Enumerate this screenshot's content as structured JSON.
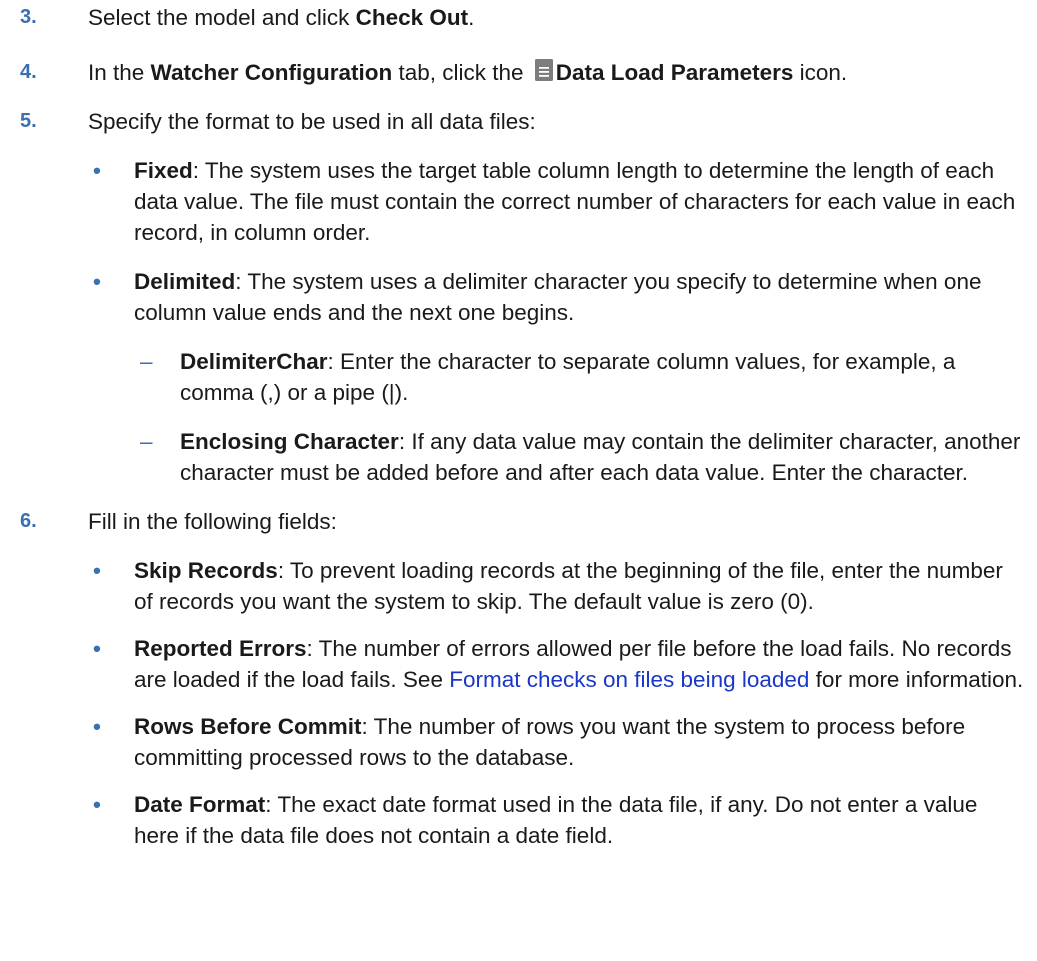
{
  "steps": [
    {
      "num": "3.",
      "pre": "Select the model and click ",
      "bold": "Check Out",
      "post": "."
    },
    {
      "num": "4.",
      "t1": "In the ",
      "b1": "Watcher Configuration",
      "t2": " tab, click the ",
      "icon": "list-document-icon",
      "b2": "Data Load Parameters",
      "t3": " icon."
    },
    {
      "num": "5.",
      "text": "Specify the format to be used in all data files:",
      "items": [
        {
          "label": "Fixed",
          "text": ": The system uses the target table column length to determine the length of each data value. The file must contain the correct number of characters for each value in each record, in column order."
        },
        {
          "label": "Delimited",
          "text": ": The system uses a delimiter character you specify to determine when one column value ends and the next one begins.",
          "subitems": [
            {
              "label": "DelimiterChar",
              "text": ": Enter the character to separate column values, for example, a comma (,) or a pipe (|)."
            },
            {
              "label": "Enclosing Character",
              "text": ": If any data value may contain the delimiter character, another character must be added before and after each data value. Enter the character."
            }
          ]
        }
      ]
    },
    {
      "num": "6.",
      "text": "Fill in the following fields:",
      "items": [
        {
          "label": "Skip Records",
          "text": ": To prevent loading records at the beginning of the file, enter the number of records you want the system to skip. The default value is zero (0)."
        },
        {
          "label": "Reported Errors",
          "text": ": The number of errors allowed per file before the load fails. No records are loaded if the load fails. See ",
          "link": "Format checks on files being loaded",
          "post": " for more information."
        },
        {
          "label": "Rows Before Commit",
          "text": ": The number of rows you want the system to process before committing processed rows to the database."
        },
        {
          "label": "Date Format",
          "text": ": The exact date format used in the data file, if any. Do not enter a value here if the data file does not contain a date field."
        }
      ]
    }
  ],
  "bullet_char": "•",
  "dash_char": "–",
  "colors": {
    "accent": "#3a6fb0",
    "link": "#1a37c8",
    "icon": "#7d7d7d"
  }
}
